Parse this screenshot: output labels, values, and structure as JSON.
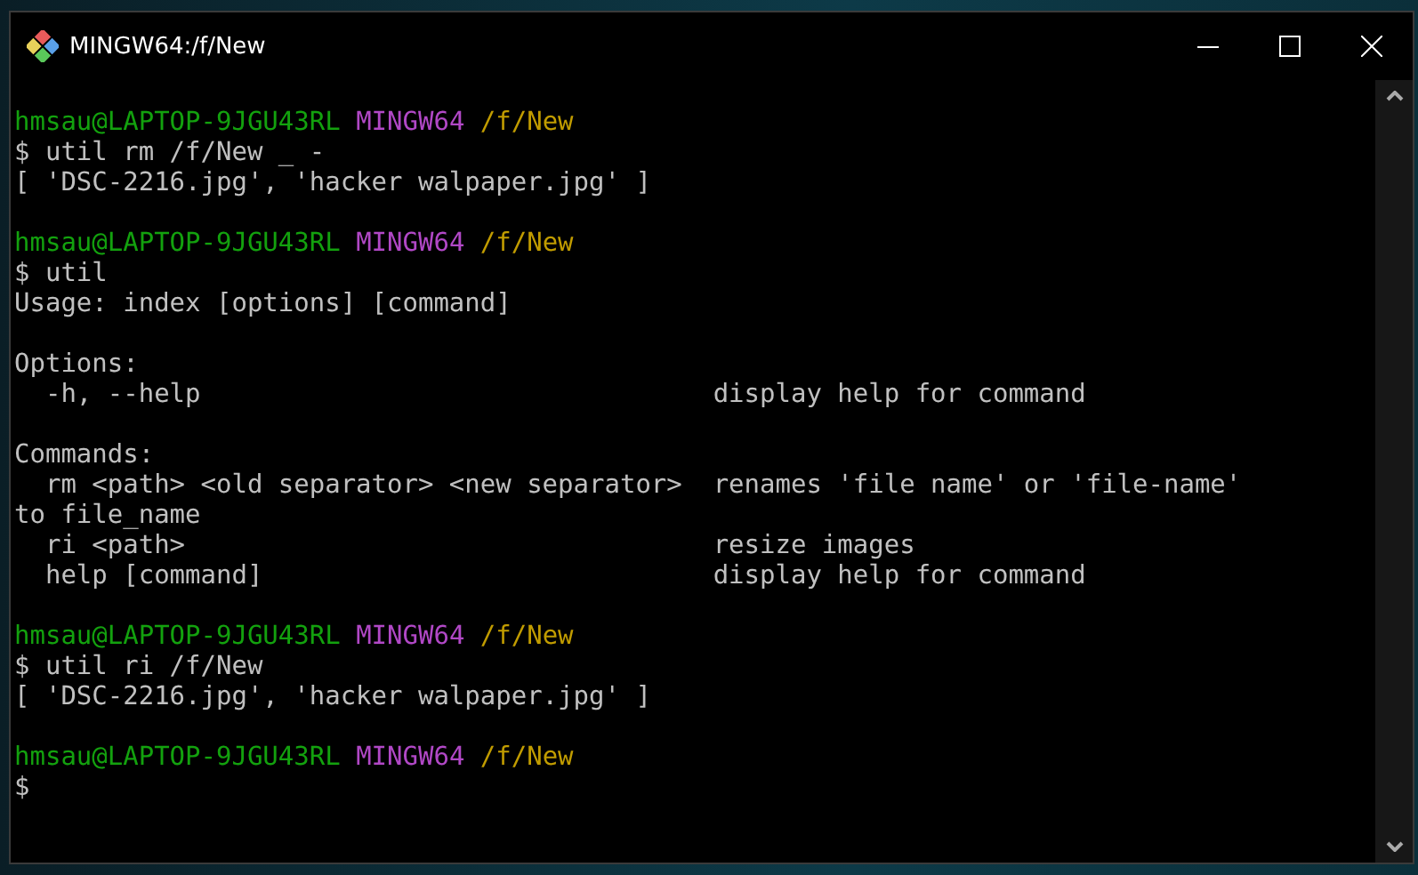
{
  "window": {
    "title": "MINGW64:/f/New"
  },
  "terminal": {
    "lines": [
      {
        "kind": "prompt",
        "user": "hmsau@LAPTOP-9JGU43RL",
        "host": "MINGW64",
        "path": "/f/New"
      },
      {
        "kind": "text",
        "text": "$ util rm /f/New _ -"
      },
      {
        "kind": "text",
        "text": "[ 'DSC-2216.jpg', 'hacker walpaper.jpg' ]"
      },
      {
        "kind": "blank"
      },
      {
        "kind": "prompt",
        "user": "hmsau@LAPTOP-9JGU43RL",
        "host": "MINGW64",
        "path": "/f/New"
      },
      {
        "kind": "text",
        "text": "$ util"
      },
      {
        "kind": "text",
        "text": "Usage: index [options] [command]"
      },
      {
        "kind": "blank"
      },
      {
        "kind": "text",
        "text": "Options:"
      },
      {
        "kind": "help",
        "left": "-h, --help",
        "right": "display help for command"
      },
      {
        "kind": "blank"
      },
      {
        "kind": "text",
        "text": "Commands:"
      },
      {
        "kind": "help",
        "left": "rm <path> <old separator> <new separator>",
        "right": "renames 'file name' or 'file-name'"
      },
      {
        "kind": "text",
        "text": "to file_name"
      },
      {
        "kind": "help",
        "left": "ri <path>",
        "right": "resize images"
      },
      {
        "kind": "help",
        "left": "help [command]",
        "right": "display help for command"
      },
      {
        "kind": "blank"
      },
      {
        "kind": "prompt",
        "user": "hmsau@LAPTOP-9JGU43RL",
        "host": "MINGW64",
        "path": "/f/New"
      },
      {
        "kind": "text",
        "text": "$ util ri /f/New"
      },
      {
        "kind": "text",
        "text": "[ 'DSC-2216.jpg', 'hacker walpaper.jpg' ]"
      },
      {
        "kind": "blank"
      },
      {
        "kind": "prompt",
        "user": "hmsau@LAPTOP-9JGU43RL",
        "host": "MINGW64",
        "path": "/f/New"
      },
      {
        "kind": "text",
        "text": "$"
      }
    ]
  }
}
